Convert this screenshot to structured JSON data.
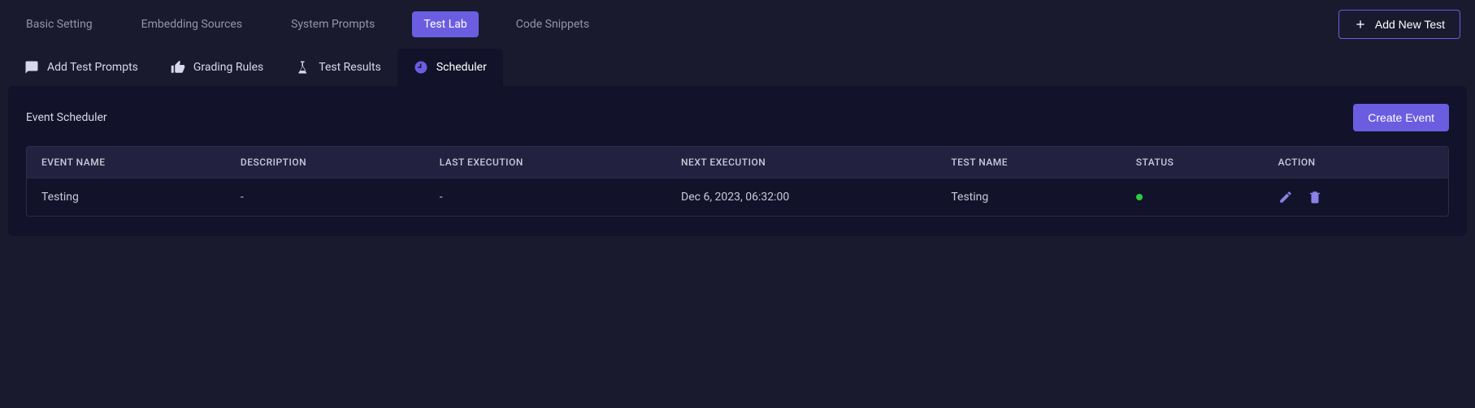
{
  "mainTabs": [
    {
      "label": "Basic Setting"
    },
    {
      "label": "Embedding Sources"
    },
    {
      "label": "System Prompts"
    },
    {
      "label": "Test Lab",
      "active": true
    },
    {
      "label": "Code Snippets"
    }
  ],
  "addTestLabel": "Add New Test",
  "subTabs": [
    {
      "label": "Add Test Prompts"
    },
    {
      "label": "Grading Rules"
    },
    {
      "label": "Test Results"
    },
    {
      "label": "Scheduler",
      "active": true
    }
  ],
  "panelTitle": "Event Scheduler",
  "createLabel": "Create Event",
  "columns": [
    "EVENT NAME",
    "DESCRIPTION",
    "LAST EXECUTION",
    "NEXT EXECUTION",
    "TEST NAME",
    "STATUS",
    "ACTION"
  ],
  "rows": [
    {
      "eventName": "Testing",
      "description": "-",
      "lastExecution": "-",
      "nextExecution": "Dec 6, 2023, 06:32:00",
      "testName": "Testing",
      "status": "green"
    }
  ]
}
